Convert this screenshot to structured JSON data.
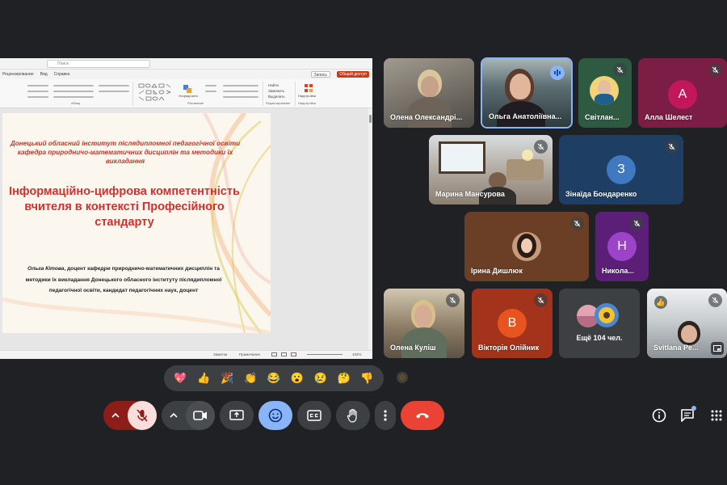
{
  "presentation": {
    "search_placeholder": "Поиск",
    "menus": [
      "Рецензирование",
      "Вид",
      "Справка"
    ],
    "record_label": "Запись",
    "share_label": "Общий доступ",
    "ribbon_groups": [
      "Абзац",
      "Рисование",
      "Редактирование",
      "Надстройки"
    ],
    "ribbon_items": {
      "arrange": "Упорядочить",
      "find": "Найти",
      "replace": "Заменить",
      "select": "Выделить",
      "addins": "Надстройки"
    },
    "status": {
      "notes": "Заметки",
      "comments": "Примечания",
      "zoom": "102%"
    },
    "slide": {
      "institute": "Донецький обласний інститут післядипломної педагогічної освіти кафедра природничо-математичних дисциплін та методики їх викладання",
      "title": "Інформаційно-цифрова компетентність вчителя в контексті Професійного стандарту",
      "author_name": "Ольга Кітова",
      "author_rest": ", доцент кафедри природничо-математичних дисциплін та методики їх викладання Донецького обласного інституту післядипломної педагогічної освіти, кандидат педагогічних наук, доцент"
    }
  },
  "participants": [
    {
      "name": "Олена Олександрі..."
    },
    {
      "name": "Ольга Анатоліївна..."
    },
    {
      "name": "Світлан..."
    },
    {
      "name": "Алла Шелест",
      "initial": "А"
    },
    {
      "name": "Марина Мансурова"
    },
    {
      "name": "Зінаїда Бондаренко",
      "initial": "З"
    },
    {
      "name": "Ірина Дишлюк"
    },
    {
      "name": "Никола...",
      "initial": "Н"
    },
    {
      "name": "Олена Куліш"
    },
    {
      "name": "Вікторія Олійник",
      "initial": "В"
    },
    {
      "name": "Ещё 104 чел."
    },
    {
      "name": "Svitlana Pe..."
    }
  ],
  "reactions": [
    "💖",
    "👍",
    "🎉",
    "👏",
    "😂",
    "😮",
    "😢",
    "🤔",
    "👎"
  ],
  "hand_reaction": "👍",
  "controls": {
    "mic": "mic-off-icon",
    "camera": "camera-icon",
    "present": "present-icon",
    "emoji": "emoji-icon",
    "captions": "captions-icon",
    "hand": "raise-hand-icon",
    "more": "more-icon",
    "leave": "end-call-icon"
  },
  "colors": {
    "background": "#202124",
    "leave": "#ea4335",
    "emoji_active": "#8ab4f8",
    "mic_off_bg": "#f9dedc",
    "mic_off_icon": "#8c1d18",
    "mic_chevron_bg": "#8c1d18"
  }
}
